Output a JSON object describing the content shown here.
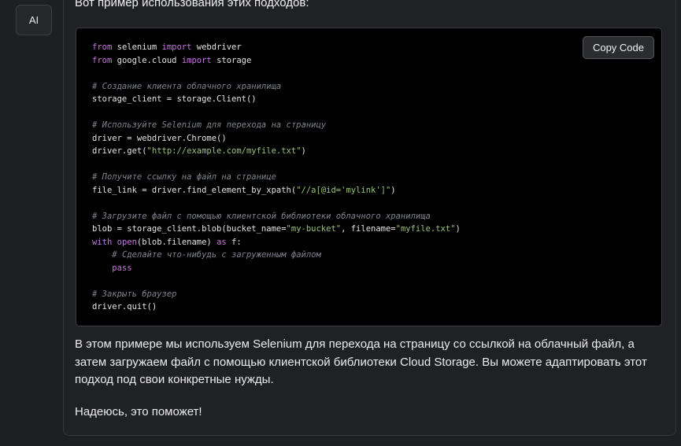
{
  "avatar": {
    "label": "AI"
  },
  "message": {
    "intro": "Вот пример использования этих подходов:",
    "copy_label": "Copy Code",
    "code_lines": [
      [
        {
          "t": "kw",
          "v": "from"
        },
        {
          "t": "plain",
          "v": " selenium "
        },
        {
          "t": "kw",
          "v": "import"
        },
        {
          "t": "plain",
          "v": " webdriver"
        }
      ],
      [
        {
          "t": "kw",
          "v": "from"
        },
        {
          "t": "plain",
          "v": " google.cloud "
        },
        {
          "t": "kw",
          "v": "import"
        },
        {
          "t": "plain",
          "v": " storage"
        }
      ],
      [],
      [
        {
          "t": "com",
          "v": "# Создание клиента облачного хранилища"
        }
      ],
      [
        {
          "t": "plain",
          "v": "storage_client = storage.Client()"
        }
      ],
      [],
      [
        {
          "t": "com",
          "v": "# Используйте Selenium для перехода на страницу"
        }
      ],
      [
        {
          "t": "plain",
          "v": "driver = webdriver.Chrome()"
        }
      ],
      [
        {
          "t": "plain",
          "v": "driver.get("
        },
        {
          "t": "str",
          "v": "\"http://example.com/myfile.txt\""
        },
        {
          "t": "plain",
          "v": ")"
        }
      ],
      [],
      [
        {
          "t": "com",
          "v": "# Получите ссылку на файл на странице"
        }
      ],
      [
        {
          "t": "plain",
          "v": "file_link = driver.find_element_by_xpath("
        },
        {
          "t": "str",
          "v": "\"//a[@id='mylink']\""
        },
        {
          "t": "plain",
          "v": ")"
        }
      ],
      [],
      [
        {
          "t": "com",
          "v": "# Загрузите файл с помощью клиентской библиотеки облачного хранилища"
        }
      ],
      [
        {
          "t": "plain",
          "v": "blob = storage_client.blob(bucket_name="
        },
        {
          "t": "str",
          "v": "\"my-bucket\""
        },
        {
          "t": "plain",
          "v": ", filename="
        },
        {
          "t": "str",
          "v": "\"myfile.txt\""
        },
        {
          "t": "plain",
          "v": ")"
        }
      ],
      [
        {
          "t": "kw",
          "v": "with"
        },
        {
          "t": "plain",
          "v": " "
        },
        {
          "t": "kw",
          "v": "open"
        },
        {
          "t": "plain",
          "v": "(blob.filename) "
        },
        {
          "t": "kw",
          "v": "as"
        },
        {
          "t": "plain",
          "v": " f:"
        }
      ],
      [
        {
          "t": "plain",
          "v": "    "
        },
        {
          "t": "com",
          "v": "# Сделайте что-нибудь с загруженным файлом"
        }
      ],
      [
        {
          "t": "plain",
          "v": "    "
        },
        {
          "t": "kw",
          "v": "pass"
        }
      ],
      [],
      [
        {
          "t": "com",
          "v": "# Закрыть браузер"
        }
      ],
      [
        {
          "t": "plain",
          "v": "driver.quit()"
        }
      ]
    ],
    "paragraph_1": "В этом примере мы используем Selenium для перехода на страницу со ссылкой на облачный файл, а затем загружаем файл с помощью клиентской библиотеки Cloud Storage. Вы можете адаптировать этот подход под свои конкретные нужды.",
    "paragraph_2": "Надеюсь, это поможет!"
  },
  "colors": {
    "background": "#1e1f22",
    "code_background": "#000000",
    "keyword": "#c678dd",
    "string": "#98c379",
    "comment": "#7f848e"
  }
}
